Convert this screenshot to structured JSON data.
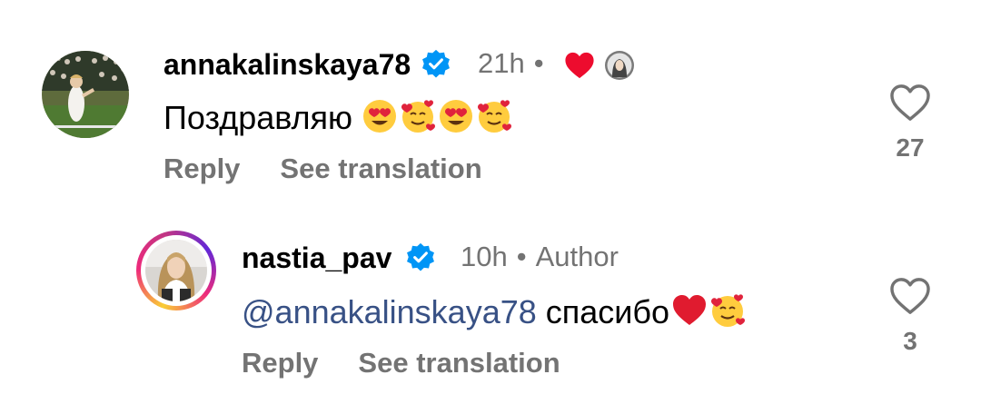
{
  "comments": [
    {
      "username": "annakalinskaya78",
      "time": "21h",
      "separator": "•",
      "text": "Поздравляю",
      "emojis": [
        "smiling-face-heart-eyes",
        "smiling-face-with-hearts",
        "smiling-face-heart-eyes",
        "smiling-face-with-hearts"
      ],
      "reply_label": "Reply",
      "translate_label": "See translation",
      "like_count": "27",
      "author_liked": true
    },
    {
      "username": "nastia_pav",
      "time": "10h",
      "separator": "•",
      "author_label": "Author",
      "mention": "@annakalinskaya78",
      "text": "спасибо",
      "emojis": [
        "red-heart",
        "smiling-face-with-hearts"
      ],
      "reply_label": "Reply",
      "translate_label": "See translation",
      "like_count": "3"
    }
  ],
  "colors": {
    "verified": "#0095f6",
    "meta": "#737373",
    "mention": "#385185",
    "heart": "#ed4956"
  }
}
